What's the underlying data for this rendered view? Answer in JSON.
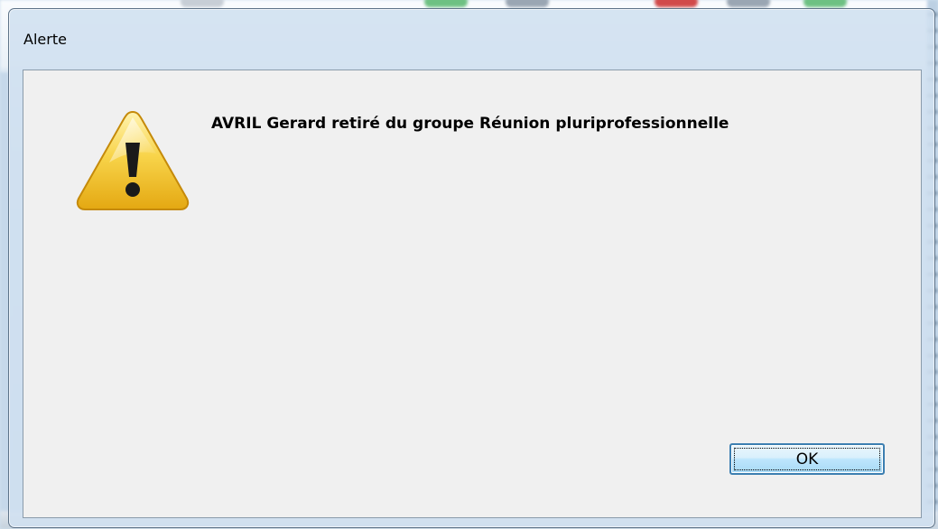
{
  "dialog": {
    "title": "Alerte",
    "message": "AVRIL Gerard retiré du groupe Réunion pluriprofessionnelle",
    "icon": "warning-icon",
    "ok_label": "OK"
  },
  "colors": {
    "client_bg": "#f0f0f0",
    "frame": "#d0e0f0",
    "button_border": "#3c7fb1",
    "icon_yellow": "#f2c230"
  }
}
